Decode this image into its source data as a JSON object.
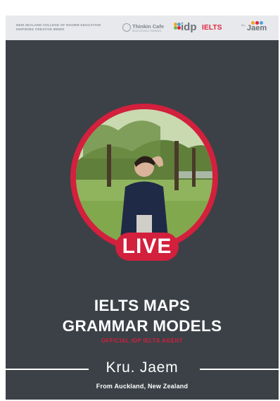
{
  "header": {
    "org_line1": "NEW ZEALAND COLLEGE OF HIGHER EDUCATION",
    "org_line2": "INSPIRING CREATIVE MINDS",
    "thinkin_name": "Thinkin Cafe",
    "thinkin_sub": "EDUCATION & TRAINING",
    "idp_label": "idp",
    "ielts_label": "IELTS",
    "kru_small": "Kru",
    "kru_big": "Jaem"
  },
  "badge": {
    "live": "LIVE"
  },
  "titles": {
    "line1": "IELTS MAPS",
    "line2": "GRAMMAR MODELS",
    "agent": "OFFICIAL IDP IELTS AGENT"
  },
  "presenter": {
    "name": "Kru. Jaem",
    "origin": "From Auckland, New Zealand"
  },
  "colors": {
    "background": "#3b4147",
    "header": "#e7e9ec",
    "accent_red": "#d2203d",
    "text": "#ffffff"
  },
  "icons": [
    "thinkin-cafe-logo-icon",
    "idp-logo-icon",
    "kru-jaem-logo-icon",
    "presenter-photo"
  ]
}
